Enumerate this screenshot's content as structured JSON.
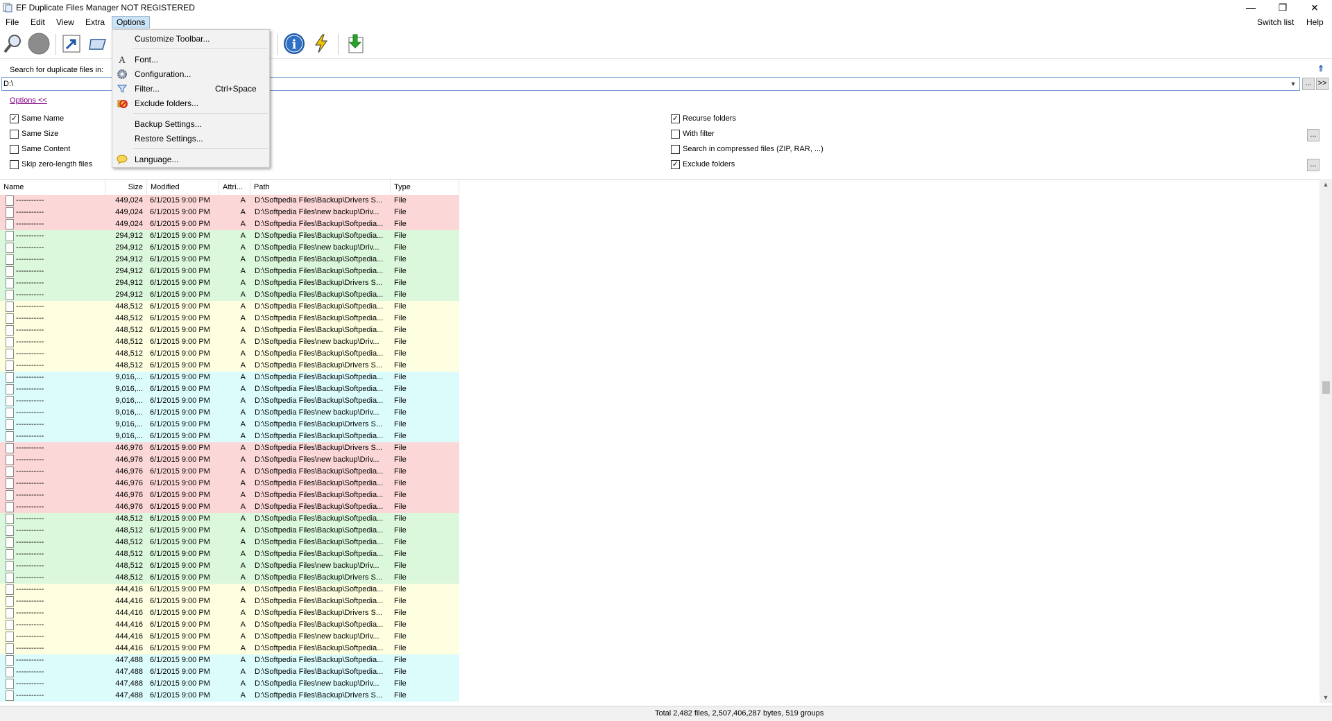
{
  "window": {
    "title": "EF Duplicate Files Manager NOT REGISTERED",
    "minimize": "—",
    "restore": "❐",
    "close": "✕"
  },
  "menubar": {
    "items": [
      "File",
      "Edit",
      "View",
      "Extra",
      "Options"
    ],
    "active": "Options",
    "right_items": [
      "Switch list",
      "Help"
    ]
  },
  "options_menu": {
    "customize_toolbar": "Customize Toolbar...",
    "font": "Font...",
    "configuration": "Configuration...",
    "filter": "Filter...",
    "filter_shortcut": "Ctrl+Space",
    "exclude_folders": "Exclude folders...",
    "backup_settings": "Backup Settings...",
    "restore_settings": "Restore Settings...",
    "language": "Language..."
  },
  "search": {
    "label": "Search for duplicate files in:",
    "path": "D:\\",
    "browse_button": "...",
    "go_button": ">>"
  },
  "options": {
    "link_label": "Options  <<",
    "same_name": {
      "label": "Same Name",
      "checked": true
    },
    "same_size": {
      "label": "Same Size",
      "checked": false
    },
    "same_content": {
      "label": "Same Content",
      "checked": false
    },
    "skip_zero": {
      "label": "Skip zero-length files",
      "checked": false
    },
    "recurse": {
      "label": "Recurse folders",
      "checked": true
    },
    "with_filter": {
      "label": "With filter",
      "checked": false
    },
    "compressed": {
      "label": "Search in compressed files (ZIP, RAR, ...)",
      "checked": false
    },
    "exclude": {
      "label": "Exclude folders",
      "checked": true
    },
    "filter_more": "...",
    "exclude_more": "..."
  },
  "table": {
    "columns": {
      "name": "Name",
      "size": "Size",
      "modified": "Modified",
      "attr": "Attri...",
      "path": "Path",
      "type": "Type"
    },
    "colors": {
      "red": "#fcd7d7",
      "green": "#dcf8dc",
      "yellow": "#fefee0",
      "cyan": "#dcfcfc"
    },
    "rows": [
      {
        "name": "-----------",
        "size": "449,024",
        "mod": "6/1/2015  9:00 PM",
        "attr": "A",
        "path": "D:\\Softpedia Files\\Backup\\Drivers S...",
        "type": "File",
        "g": "red"
      },
      {
        "name": "-----------",
        "size": "449,024",
        "mod": "6/1/2015  9:00 PM",
        "attr": "A",
        "path": "D:\\Softpedia Files\\new backup\\Driv...",
        "type": "File",
        "g": "red"
      },
      {
        "name": "-----------",
        "size": "449,024",
        "mod": "6/1/2015  9:00 PM",
        "attr": "A",
        "path": "D:\\Softpedia Files\\Backup\\Softpedia...",
        "type": "File",
        "g": "red"
      },
      {
        "name": "-----------",
        "size": "294,912",
        "mod": "6/1/2015  9:00 PM",
        "attr": "A",
        "path": "D:\\Softpedia Files\\Backup\\Softpedia...",
        "type": "File",
        "g": "green"
      },
      {
        "name": "-----------",
        "size": "294,912",
        "mod": "6/1/2015  9:00 PM",
        "attr": "A",
        "path": "D:\\Softpedia Files\\new backup\\Driv...",
        "type": "File",
        "g": "green"
      },
      {
        "name": "-----------",
        "size": "294,912",
        "mod": "6/1/2015  9:00 PM",
        "attr": "A",
        "path": "D:\\Softpedia Files\\Backup\\Softpedia...",
        "type": "File",
        "g": "green"
      },
      {
        "name": "-----------",
        "size": "294,912",
        "mod": "6/1/2015  9:00 PM",
        "attr": "A",
        "path": "D:\\Softpedia Files\\Backup\\Softpedia...",
        "type": "File",
        "g": "green"
      },
      {
        "name": "-----------",
        "size": "294,912",
        "mod": "6/1/2015  9:00 PM",
        "attr": "A",
        "path": "D:\\Softpedia Files\\Backup\\Drivers S...",
        "type": "File",
        "g": "green"
      },
      {
        "name": "-----------",
        "size": "294,912",
        "mod": "6/1/2015  9:00 PM",
        "attr": "A",
        "path": "D:\\Softpedia Files\\Backup\\Softpedia...",
        "type": "File",
        "g": "green"
      },
      {
        "name": "-----------",
        "size": "448,512",
        "mod": "6/1/2015  9:00 PM",
        "attr": "A",
        "path": "D:\\Softpedia Files\\Backup\\Softpedia...",
        "type": "File",
        "g": "yellow"
      },
      {
        "name": "-----------",
        "size": "448,512",
        "mod": "6/1/2015  9:00 PM",
        "attr": "A",
        "path": "D:\\Softpedia Files\\Backup\\Softpedia...",
        "type": "File",
        "g": "yellow"
      },
      {
        "name": "-----------",
        "size": "448,512",
        "mod": "6/1/2015  9:00 PM",
        "attr": "A",
        "path": "D:\\Softpedia Files\\Backup\\Softpedia...",
        "type": "File",
        "g": "yellow"
      },
      {
        "name": "-----------",
        "size": "448,512",
        "mod": "6/1/2015  9:00 PM",
        "attr": "A",
        "path": "D:\\Softpedia Files\\new backup\\Driv...",
        "type": "File",
        "g": "yellow"
      },
      {
        "name": "-----------",
        "size": "448,512",
        "mod": "6/1/2015  9:00 PM",
        "attr": "A",
        "path": "D:\\Softpedia Files\\Backup\\Softpedia...",
        "type": "File",
        "g": "yellow"
      },
      {
        "name": "-----------",
        "size": "448,512",
        "mod": "6/1/2015  9:00 PM",
        "attr": "A",
        "path": "D:\\Softpedia Files\\Backup\\Drivers S...",
        "type": "File",
        "g": "yellow"
      },
      {
        "name": "-----------",
        "size": "9,016,...",
        "mod": "6/1/2015  9:00 PM",
        "attr": "A",
        "path": "D:\\Softpedia Files\\Backup\\Softpedia...",
        "type": "File",
        "g": "cyan"
      },
      {
        "name": "-----------",
        "size": "9,016,...",
        "mod": "6/1/2015  9:00 PM",
        "attr": "A",
        "path": "D:\\Softpedia Files\\Backup\\Softpedia...",
        "type": "File",
        "g": "cyan"
      },
      {
        "name": "-----------",
        "size": "9,016,...",
        "mod": "6/1/2015  9:00 PM",
        "attr": "A",
        "path": "D:\\Softpedia Files\\Backup\\Softpedia...",
        "type": "File",
        "g": "cyan"
      },
      {
        "name": "-----------",
        "size": "9,016,...",
        "mod": "6/1/2015  9:00 PM",
        "attr": "A",
        "path": "D:\\Softpedia Files\\new backup\\Driv...",
        "type": "File",
        "g": "cyan"
      },
      {
        "name": "-----------",
        "size": "9,016,...",
        "mod": "6/1/2015  9:00 PM",
        "attr": "A",
        "path": "D:\\Softpedia Files\\Backup\\Drivers S...",
        "type": "File",
        "g": "cyan"
      },
      {
        "name": "-----------",
        "size": "9,016,...",
        "mod": "6/1/2015  9:00 PM",
        "attr": "A",
        "path": "D:\\Softpedia Files\\Backup\\Softpedia...",
        "type": "File",
        "g": "cyan"
      },
      {
        "name": "-----------",
        "size": "446,976",
        "mod": "6/1/2015  9:00 PM",
        "attr": "A",
        "path": "D:\\Softpedia Files\\Backup\\Drivers S...",
        "type": "File",
        "g": "red"
      },
      {
        "name": "-----------",
        "size": "446,976",
        "mod": "6/1/2015  9:00 PM",
        "attr": "A",
        "path": "D:\\Softpedia Files\\new backup\\Driv...",
        "type": "File",
        "g": "red"
      },
      {
        "name": "-----------",
        "size": "446,976",
        "mod": "6/1/2015  9:00 PM",
        "attr": "A",
        "path": "D:\\Softpedia Files\\Backup\\Softpedia...",
        "type": "File",
        "g": "red"
      },
      {
        "name": "-----------",
        "size": "446,976",
        "mod": "6/1/2015  9:00 PM",
        "attr": "A",
        "path": "D:\\Softpedia Files\\Backup\\Softpedia...",
        "type": "File",
        "g": "red"
      },
      {
        "name": "-----------",
        "size": "446,976",
        "mod": "6/1/2015  9:00 PM",
        "attr": "A",
        "path": "D:\\Softpedia Files\\Backup\\Softpedia...",
        "type": "File",
        "g": "red"
      },
      {
        "name": "-----------",
        "size": "446,976",
        "mod": "6/1/2015  9:00 PM",
        "attr": "A",
        "path": "D:\\Softpedia Files\\Backup\\Softpedia...",
        "type": "File",
        "g": "red"
      },
      {
        "name": "-----------",
        "size": "448,512",
        "mod": "6/1/2015  9:00 PM",
        "attr": "A",
        "path": "D:\\Softpedia Files\\Backup\\Softpedia...",
        "type": "File",
        "g": "green"
      },
      {
        "name": "-----------",
        "size": "448,512",
        "mod": "6/1/2015  9:00 PM",
        "attr": "A",
        "path": "D:\\Softpedia Files\\Backup\\Softpedia...",
        "type": "File",
        "g": "green"
      },
      {
        "name": "-----------",
        "size": "448,512",
        "mod": "6/1/2015  9:00 PM",
        "attr": "A",
        "path": "D:\\Softpedia Files\\Backup\\Softpedia...",
        "type": "File",
        "g": "green"
      },
      {
        "name": "-----------",
        "size": "448,512",
        "mod": "6/1/2015  9:00 PM",
        "attr": "A",
        "path": "D:\\Softpedia Files\\Backup\\Softpedia...",
        "type": "File",
        "g": "green"
      },
      {
        "name": "-----------",
        "size": "448,512",
        "mod": "6/1/2015  9:00 PM",
        "attr": "A",
        "path": "D:\\Softpedia Files\\new backup\\Driv...",
        "type": "File",
        "g": "green"
      },
      {
        "name": "-----------",
        "size": "448,512",
        "mod": "6/1/2015  9:00 PM",
        "attr": "A",
        "path": "D:\\Softpedia Files\\Backup\\Drivers S...",
        "type": "File",
        "g": "green"
      },
      {
        "name": "-----------",
        "size": "444,416",
        "mod": "6/1/2015  9:00 PM",
        "attr": "A",
        "path": "D:\\Softpedia Files\\Backup\\Softpedia...",
        "type": "File",
        "g": "yellow"
      },
      {
        "name": "-----------",
        "size": "444,416",
        "mod": "6/1/2015  9:00 PM",
        "attr": "A",
        "path": "D:\\Softpedia Files\\Backup\\Softpedia...",
        "type": "File",
        "g": "yellow"
      },
      {
        "name": "-----------",
        "size": "444,416",
        "mod": "6/1/2015  9:00 PM",
        "attr": "A",
        "path": "D:\\Softpedia Files\\Backup\\Drivers S...",
        "type": "File",
        "g": "yellow"
      },
      {
        "name": "-----------",
        "size": "444,416",
        "mod": "6/1/2015  9:00 PM",
        "attr": "A",
        "path": "D:\\Softpedia Files\\Backup\\Softpedia...",
        "type": "File",
        "g": "yellow"
      },
      {
        "name": "-----------",
        "size": "444,416",
        "mod": "6/1/2015  9:00 PM",
        "attr": "A",
        "path": "D:\\Softpedia Files\\new backup\\Driv...",
        "type": "File",
        "g": "yellow"
      },
      {
        "name": "-----------",
        "size": "444,416",
        "mod": "6/1/2015  9:00 PM",
        "attr": "A",
        "path": "D:\\Softpedia Files\\Backup\\Softpedia...",
        "type": "File",
        "g": "yellow"
      },
      {
        "name": "-----------",
        "size": "447,488",
        "mod": "6/1/2015  9:00 PM",
        "attr": "A",
        "path": "D:\\Softpedia Files\\Backup\\Softpedia...",
        "type": "File",
        "g": "cyan"
      },
      {
        "name": "-----------",
        "size": "447,488",
        "mod": "6/1/2015  9:00 PM",
        "attr": "A",
        "path": "D:\\Softpedia Files\\Backup\\Softpedia...",
        "type": "File",
        "g": "cyan"
      },
      {
        "name": "-----------",
        "size": "447,488",
        "mod": "6/1/2015  9:00 PM",
        "attr": "A",
        "path": "D:\\Softpedia Files\\new backup\\Driv...",
        "type": "File",
        "g": "cyan"
      },
      {
        "name": "-----------",
        "size": "447,488",
        "mod": "6/1/2015  9:00 PM",
        "attr": "A",
        "path": "D:\\Softpedia Files\\Backup\\Drivers S...",
        "type": "File",
        "g": "cyan"
      }
    ]
  },
  "status": {
    "text": "Total 2,482 files, 2,507,406,287 bytes, 519 groups"
  },
  "scrollbar": {
    "up": "▲",
    "down": "▼"
  }
}
